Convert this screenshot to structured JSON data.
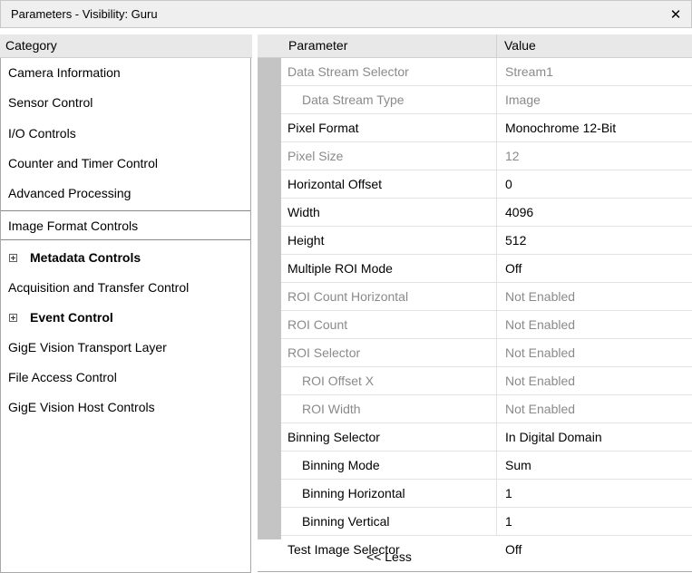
{
  "window": {
    "title": "Parameters - Visibility: Guru",
    "close_glyph": "✕"
  },
  "categories": {
    "header": "Category",
    "items": [
      {
        "label": "Camera Information"
      },
      {
        "label": "Sensor Control"
      },
      {
        "label": "I/O Controls"
      },
      {
        "label": "Counter and Timer Control"
      },
      {
        "label": "Advanced Processing"
      },
      {
        "label": "Image Format Controls",
        "selected": true
      },
      {
        "label": "Metadata Controls",
        "group": true
      },
      {
        "label": "Acquisition and Transfer Control"
      },
      {
        "label": "Event Control",
        "group": true
      },
      {
        "label": "GigE Vision Transport Layer"
      },
      {
        "label": "File Access Control"
      },
      {
        "label": "GigE Vision Host Controls"
      }
    ]
  },
  "grid": {
    "header_parameter": "Parameter",
    "header_value": "Value",
    "rows": [
      {
        "name": "Data Stream Selector",
        "value": "Stream1",
        "enabled": false
      },
      {
        "name": "Data Stream Type",
        "value": "Image",
        "enabled": false
      },
      {
        "name": "Pixel Format",
        "value": "Monochrome 12-Bit",
        "enabled": true
      },
      {
        "name": "Pixel Size",
        "value": "12",
        "enabled": false
      },
      {
        "name": "Horizontal Offset",
        "value": "0",
        "enabled": true
      },
      {
        "name": "Width",
        "value": "4096",
        "enabled": true
      },
      {
        "name": "Height",
        "value": "512",
        "enabled": true
      },
      {
        "name": "Multiple ROI Mode",
        "value": "Off",
        "enabled": true
      },
      {
        "name": "ROI Count Horizontal",
        "value": "Not Enabled",
        "enabled": false
      },
      {
        "name": "ROI Count",
        "value": "Not Enabled",
        "enabled": false
      },
      {
        "name": "ROI Selector",
        "value": "Not Enabled",
        "enabled": false
      },
      {
        "name": "ROI Offset X",
        "value": "Not Enabled",
        "enabled": false
      },
      {
        "name": "ROI Width",
        "value": "Not Enabled",
        "enabled": false
      },
      {
        "name": "Binning Selector",
        "value": "In Digital Domain",
        "enabled": true
      },
      {
        "name": "Binning Mode",
        "value": "Sum",
        "enabled": true
      },
      {
        "name": "Binning Horizontal",
        "value": "1",
        "enabled": true
      },
      {
        "name": "Binning Vertical",
        "value": "1",
        "enabled": true
      },
      {
        "name": "Test Image Selector",
        "value": "Off",
        "enabled": true
      }
    ],
    "less_label": "<< Less"
  },
  "colors": {
    "disabled_text": "#8a8a8a",
    "gutter": "#c4c4c4",
    "header_bg": "#e8e8e8"
  }
}
